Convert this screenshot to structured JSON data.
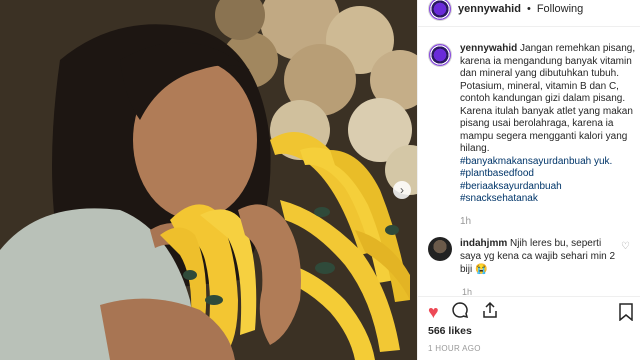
{
  "post": {
    "username": "yennywahid",
    "separator": "•",
    "follow_state": "Following",
    "caption_text": "Jangan remehkan pisang, karena ia mengandung banyak vitamin dan mineral yang dibutuhkan tubuh. Potasium, mineral, vitamin B dan C, contoh kandungan gizi dalam pisang. Karena itulah banyak atlet yang makan pisang usai berolahraga, karena ia mampu segera mengganti kalori yang hilang.",
    "hashtags": [
      "#banyakmakansayurdanbuah yuk.",
      "#plantbasedfood",
      "#beriaaksayurdanbuah",
      "#snacksehatanak"
    ],
    "caption_time": "1h",
    "likes": "566 likes",
    "posted_time": "1 HOUR AGO"
  },
  "comment": {
    "username": "indahjmm",
    "text": "Njih leres bu, seperti saya yg kena ca wajib sehari min 2 biji 😭",
    "reply": "1h"
  },
  "icons": {
    "next": "chevron-right-icon",
    "like": "heart-icon",
    "comment": "comment-icon",
    "share": "share-icon",
    "save": "bookmark-icon"
  },
  "colors": {
    "like_red": "#ed4956",
    "hashtag_blue": "#003569",
    "text": "#262626",
    "muted": "#999999"
  }
}
